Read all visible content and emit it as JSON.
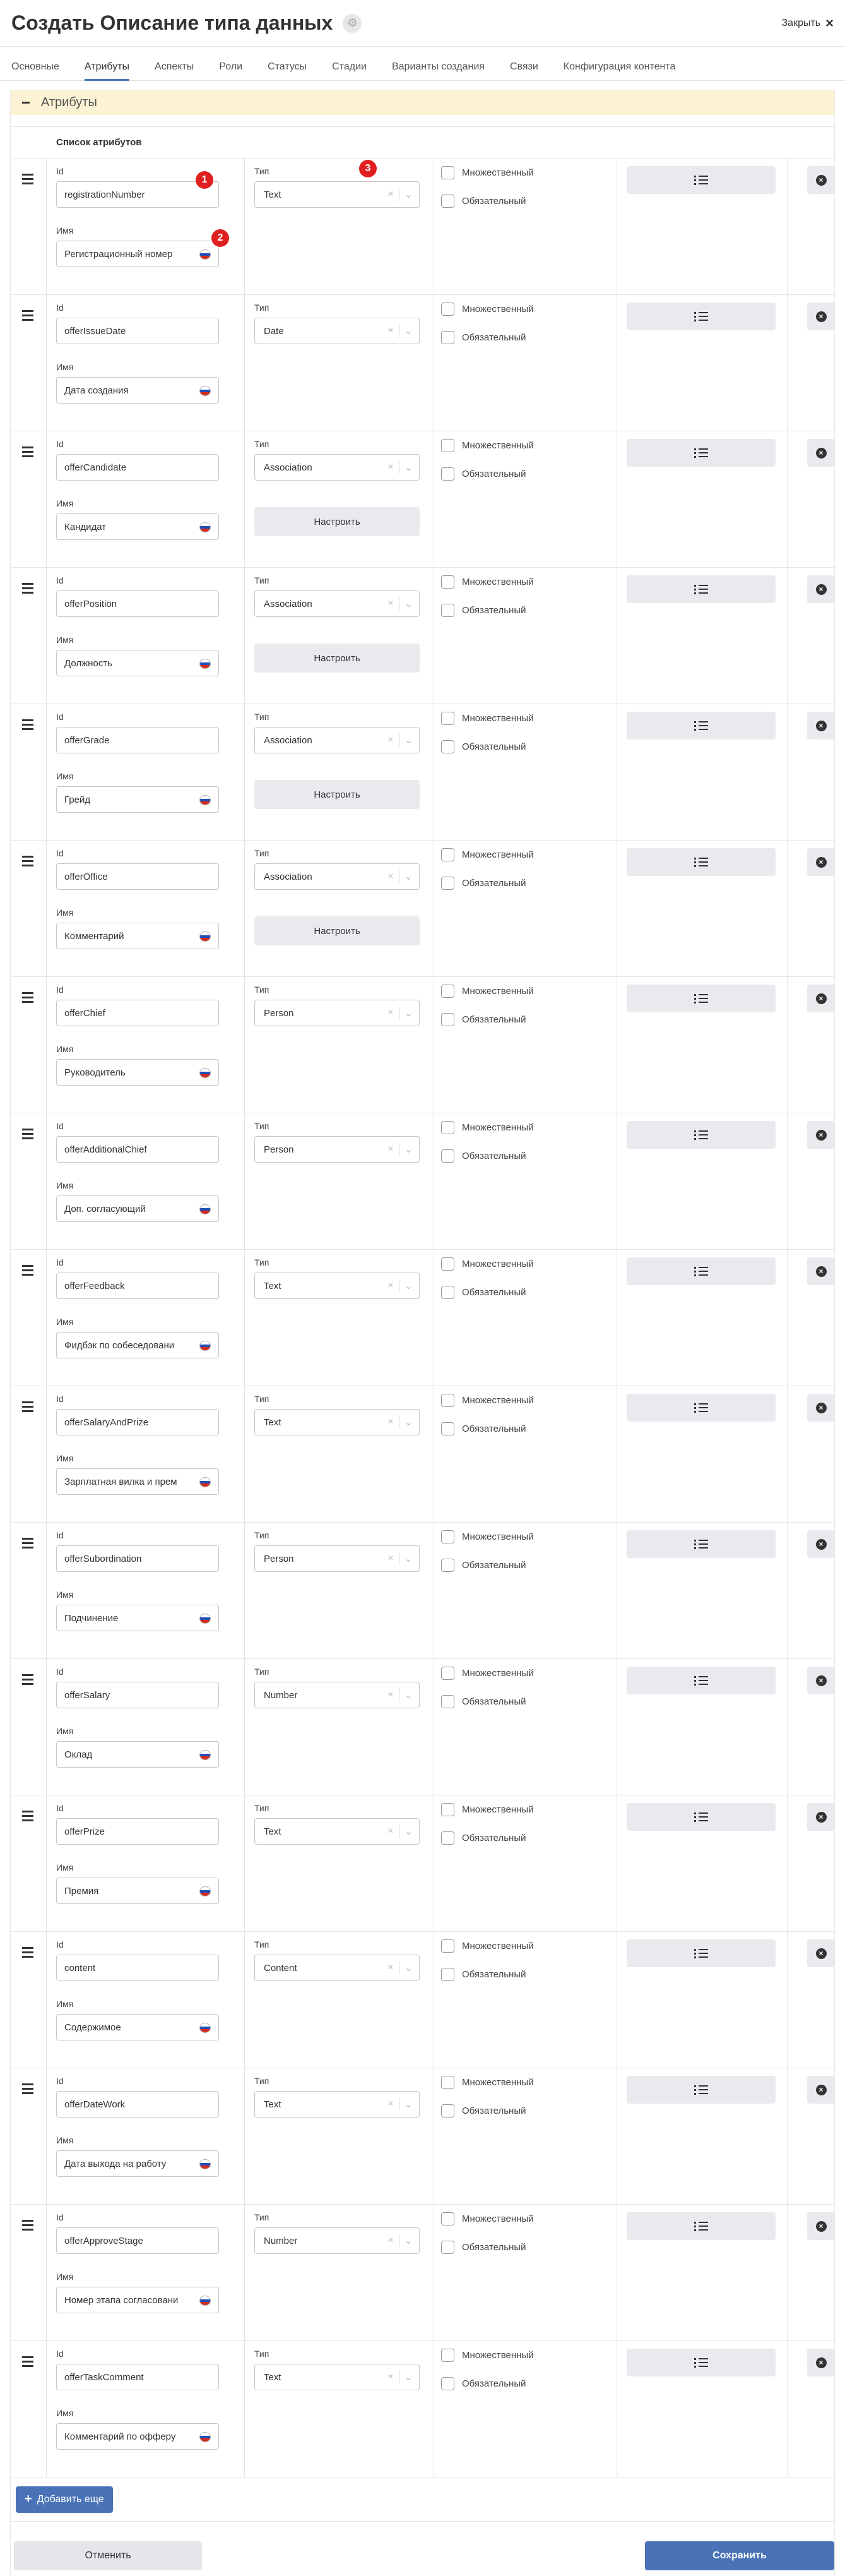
{
  "header": {
    "title": "Создать Описание типа данных",
    "settings_icon": "gear-icon",
    "close_label": "Закрыть"
  },
  "tabs": [
    {
      "label": "Основные",
      "active": false
    },
    {
      "label": "Атрибуты",
      "active": true
    },
    {
      "label": "Аспекты",
      "active": false
    },
    {
      "label": "Роли",
      "active": false
    },
    {
      "label": "Статусы",
      "active": false
    },
    {
      "label": "Стадии",
      "active": false
    },
    {
      "label": "Варианты создания",
      "active": false
    },
    {
      "label": "Связи",
      "active": false
    },
    {
      "label": "Конфигурация контента",
      "active": false
    }
  ],
  "section": {
    "title": "Атрибуты",
    "list_header": "Список атрибутов"
  },
  "labels": {
    "id": "Id",
    "name": "Имя",
    "type": "Тип",
    "multiple": "Множественный",
    "required": "Обязательный",
    "configure": "Настроить"
  },
  "rows": [
    {
      "id": "registrationNumber",
      "name": "Регистрационный номер",
      "type": "Text",
      "configure": false
    },
    {
      "id": "offerIssueDate",
      "name": "Дата создания",
      "type": "Date",
      "configure": false
    },
    {
      "id": "offerCandidate",
      "name": "Кандидат",
      "type": "Association",
      "configure": true
    },
    {
      "id": "offerPosition",
      "name": "Должность",
      "type": "Association",
      "configure": true
    },
    {
      "id": "offerGrade",
      "name": "Грейд",
      "type": "Association",
      "configure": true
    },
    {
      "id": "offerOffice",
      "name": "Комментарий",
      "type": "Association",
      "configure": true
    },
    {
      "id": "offerChief",
      "name": "Руководитель",
      "type": "Person",
      "configure": false
    },
    {
      "id": "offerAdditionalChief",
      "name": "Доп. согласующий",
      "type": "Person",
      "configure": false
    },
    {
      "id": "offerFeedback",
      "name": "Фидбэк по собеседовани",
      "type": "Text",
      "configure": false
    },
    {
      "id": "offerSalaryAndPrize",
      "name": "Зарплатная вилка и прем",
      "type": "Text",
      "configure": false
    },
    {
      "id": "offerSubordination",
      "name": "Подчинение",
      "type": "Person",
      "configure": false
    },
    {
      "id": "offerSalary",
      "name": "Оклад",
      "type": "Number",
      "configure": false
    },
    {
      "id": "offerPrize",
      "name": "Премия",
      "type": "Text",
      "configure": false
    },
    {
      "id": "content",
      "name": "Содержимое",
      "type": "Content",
      "configure": false
    },
    {
      "id": "offerDateWork",
      "name": "Дата выхода на работу",
      "type": "Text",
      "configure": false
    },
    {
      "id": "offerApproveStage",
      "name": "Номер этапа согласовани",
      "type": "Number",
      "configure": false
    },
    {
      "id": "offerTaskComment",
      "name": "Комментарий по офферу",
      "type": "Text",
      "configure": false
    }
  ],
  "markers": [
    "1",
    "2",
    "3"
  ],
  "add_button": "Добавить еще",
  "footer": {
    "cancel": "Отменить",
    "save": "Сохранить"
  },
  "colors": {
    "accent": "#4a73b7",
    "section_header_bg": "#fcf3d4",
    "marker": "#e02020"
  }
}
